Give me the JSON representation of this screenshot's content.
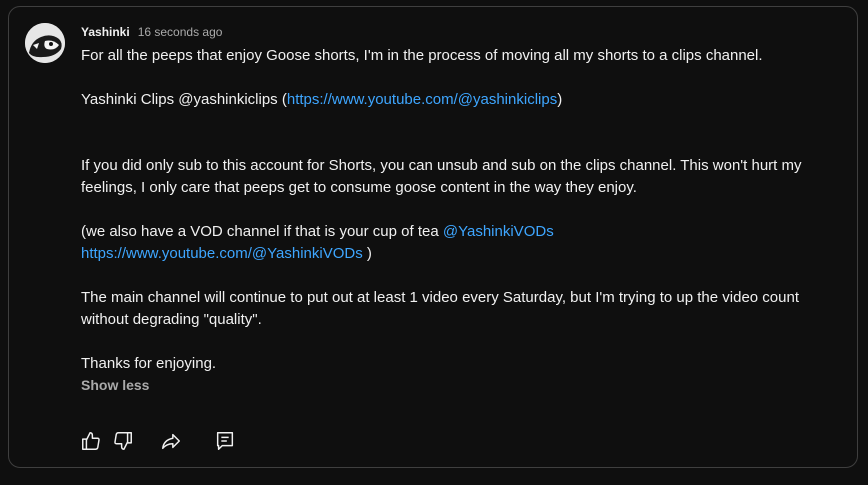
{
  "post": {
    "author": "Yashinki",
    "timestamp": "16 seconds ago",
    "p1": "For all the peeps that enjoy Goose shorts, I'm in the process of moving all my shorts to a clips channel.",
    "p2_text": "Yashinki Clips @yashinkiclips (",
    "p2_link": "https://www.youtube.com/@yashinkiclips",
    "p2_end": ")",
    "p3": "If you did only sub to this account for Shorts, you can unsub and sub on the clips channel. This won't hurt my feelings, I only care that peeps get to consume goose content in the way they enjoy.",
    "p4_text": "(we also have a VOD channel if that is your cup of tea ",
    "p4_mention": "@YashinkiVODs",
    "p4_link": "https://www.youtube.com/@YashinkiVODs",
    "p4_end": " )",
    "p5": "The main channel will continue to put out at least 1 video every Saturday, but I'm trying to up the video count without degrading \"quality\".",
    "p6": "Thanks for enjoying.",
    "show_less": "Show less"
  },
  "actions": [
    "like-icon",
    "dislike-icon",
    "share-icon",
    "reply-icon"
  ],
  "colors": {
    "background": "#0f0f0f",
    "border": "#3f3f3f",
    "text": "#f1f1f1",
    "secondary_text": "#aaaaaa",
    "link": "#3ea6ff"
  }
}
